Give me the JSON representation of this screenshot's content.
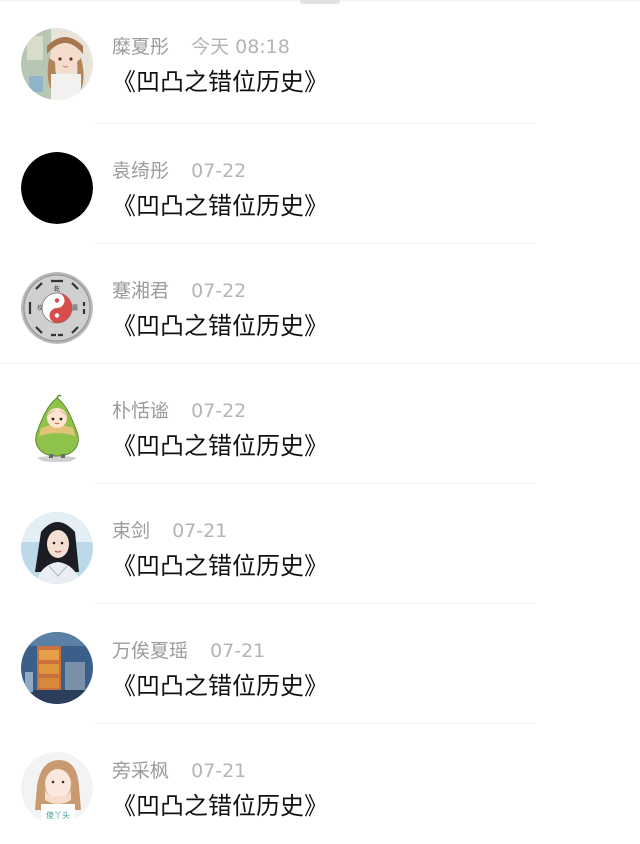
{
  "comments": [
    {
      "name": "糜夏彤",
      "time": "今天 08:18",
      "content": "《凹凸之错位历史》",
      "avatar": "anime-girl-avatar"
    },
    {
      "name": "袁绮彤",
      "time": "07-22",
      "content": "《凹凸之错位历史》",
      "avatar": "black-circle-avatar"
    },
    {
      "name": "蹇湘君",
      "time": "07-22",
      "content": "《凹凸之错位历史》",
      "avatar": "bagua-avatar"
    },
    {
      "name": "朴恬谧",
      "time": "07-22",
      "content": "《凹凸之错位历史》",
      "avatar": "zongzi-cartoon-avatar"
    },
    {
      "name": "束剑",
      "time": "07-21",
      "content": "《凹凸之错位历史》",
      "avatar": "costume-woman-avatar"
    },
    {
      "name": "万俟夏瑶",
      "time": "07-21",
      "content": "《凹凸之错位历史》",
      "avatar": "temple-scene-avatar"
    },
    {
      "name": "旁采枫",
      "time": "07-21",
      "content": "《凹凸之错位历史》",
      "avatar": "girl-hands-face-avatar"
    }
  ],
  "avatar_texts": {
    "bagua_top": "乾",
    "bagua_left": "坎",
    "bagua_right": "震",
    "girl_caption": "傻丫头"
  },
  "colors": {
    "name_gray": "#9b9b9b",
    "time_gray": "#b4b4b4",
    "content_black": "#111111",
    "divider": "#f1f1f1"
  }
}
